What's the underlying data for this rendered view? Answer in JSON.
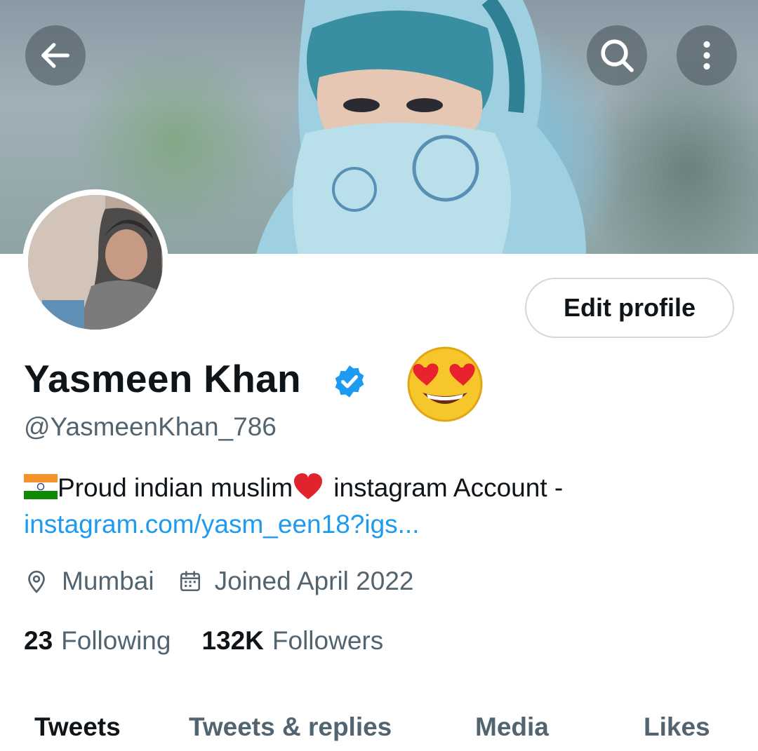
{
  "header": {
    "back_icon": "arrow-left-icon",
    "search_icon": "search-icon",
    "more_icon": "more-vertical-icon"
  },
  "profile": {
    "name": "Yasmeen Khan",
    "handle": "@YasmeenKhan_786",
    "edit_button": "Edit profile",
    "bio_text_1": "Proud indian muslim",
    "bio_text_2": "instagram Account -",
    "bio_link": "instagram.com/yasm_een18?igs...",
    "location": "Mumbai",
    "joined": "Joined April 2022",
    "following_count": "23",
    "following_label": "Following",
    "followers_count": "132K",
    "followers_label": "Followers"
  },
  "tabs": [
    "Tweets",
    "Tweets & replies",
    "Media",
    "Likes"
  ],
  "colors": {
    "accent": "#1d9bf0",
    "text_primary": "#0f1419",
    "text_secondary": "#536471",
    "border": "#cfd9de"
  }
}
